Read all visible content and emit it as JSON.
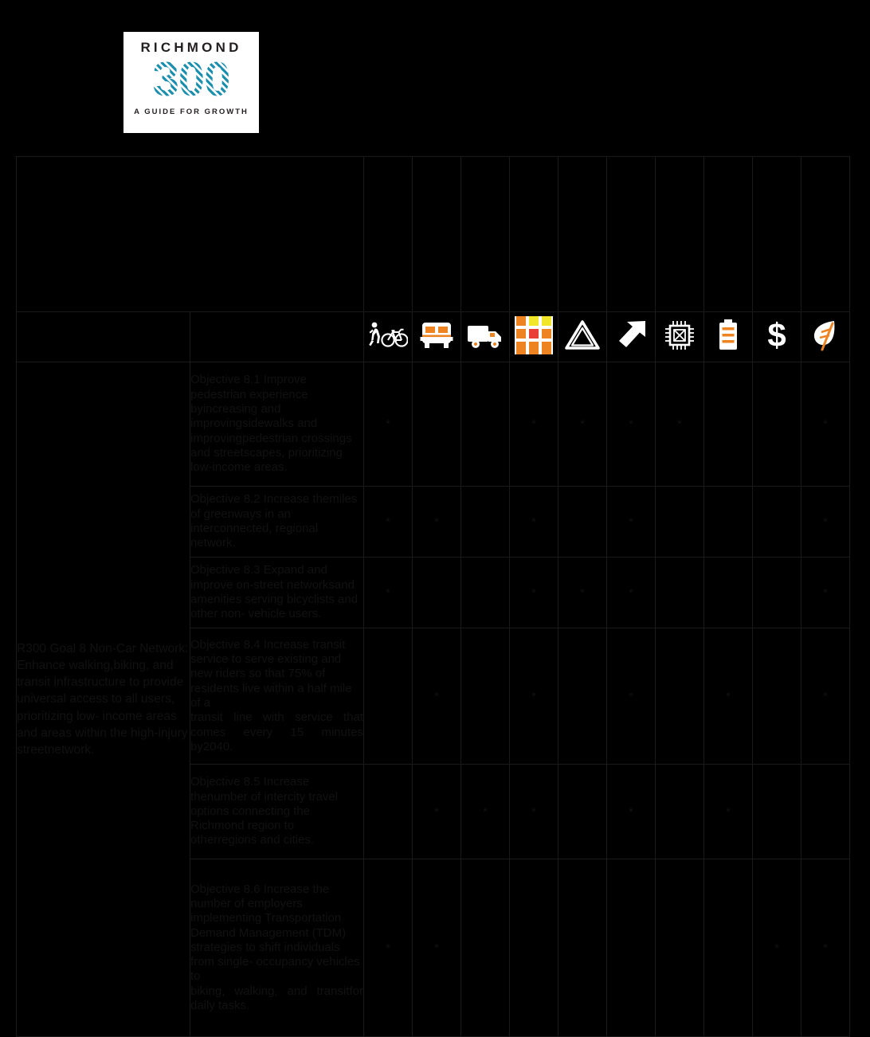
{
  "logo": {
    "word": "RICHMOND",
    "number": "300",
    "tagline": "A GUIDE FOR GROWTH"
  },
  "colors": {
    "accent_orange": "#ee8322",
    "cell_green": "#b5d0a0",
    "background": "#000000",
    "logo_teal": "#1b8fae",
    "grid_yellow": "#f2e62b",
    "grid_red": "#ea3f37"
  },
  "header": {
    "blank_goal_label": "",
    "blank_objective_label": "",
    "icons": [
      {
        "id": 1,
        "name": "pedestrian-bicycle-icon",
        "title": "Walking and Biking"
      },
      {
        "id": 2,
        "name": "bus-icon",
        "title": "Transit"
      },
      {
        "id": 3,
        "name": "truck-icon",
        "title": "Freight"
      },
      {
        "id": 4,
        "name": "street-grid-icon",
        "title": "Street Grid"
      },
      {
        "id": 5,
        "name": "warning-triangle-icon",
        "title": "Safety"
      },
      {
        "id": 6,
        "name": "arrow-up-right-icon",
        "title": "Growth"
      },
      {
        "id": 7,
        "name": "microchip-icon",
        "title": "Technology"
      },
      {
        "id": 8,
        "name": "battery-icon",
        "title": "Energy"
      },
      {
        "id": 9,
        "name": "dollar-sign-icon",
        "title": "Cost"
      },
      {
        "id": 10,
        "name": "leaf-icon",
        "title": "Environment"
      }
    ]
  },
  "goal": {
    "text": "R300 Goal 8 Non-Car Network: Enhance walking,biking, and transit infrastructure to provide universal access to all users, prioritizing low- income areas and areas within the high-injury streetnetwork."
  },
  "marker": "*",
  "rows": [
    {
      "id": "8.1",
      "text": "Objective 8.1 Improve pedestrian experience byincreasing and improvingsidewalks and improvingpedestrian crossings and streetscapes, prioritizing low-income areas.",
      "tail": "",
      "marks": [
        1,
        0,
        0,
        1,
        1,
        1,
        1,
        0,
        0,
        1
      ]
    },
    {
      "id": "8.2",
      "text": "Objective 8.2 Increase themiles of greenways in an interconnected, regional network.",
      "tail": "",
      "marks": [
        1,
        1,
        0,
        1,
        0,
        1,
        0,
        0,
        0,
        1
      ]
    },
    {
      "id": "8.3",
      "text": "Objective 8.3 Expand and improve on-street networksand amenities serving bicyclists and other non- vehicle users.",
      "tail": "",
      "marks": [
        1,
        0,
        0,
        1,
        1,
        1,
        0,
        0,
        0,
        1
      ]
    },
    {
      "id": "8.4",
      "text": "Objective 8.4 Increase transit service to serve existing and new riders so that 75% of residents live within a half mile of a",
      "tail": "transit line with service that comes every 15 minutes by2040.",
      "marks": [
        0,
        1,
        0,
        1,
        0,
        1,
        0,
        1,
        0,
        1
      ]
    },
    {
      "id": "8.5",
      "text": "Objective 8.5 Increase thenumber of intercity travel options connecting the Richmond region to otherregions and cities.",
      "tail": "",
      "marks": [
        0,
        1,
        1,
        1,
        0,
        1,
        0,
        1,
        0,
        0
      ]
    },
    {
      "id": "8.6",
      "text": "Objective 8.6 Increase the number of employers implementing Transportation Demand Management (TDM) strategies to shift individuals from single- occupancy vehicles to",
      "tail": "biking, walking, and transitfor daily tasks.",
      "marks": [
        1,
        1,
        0,
        0,
        0,
        0,
        0,
        0,
        1,
        1
      ]
    }
  ]
}
